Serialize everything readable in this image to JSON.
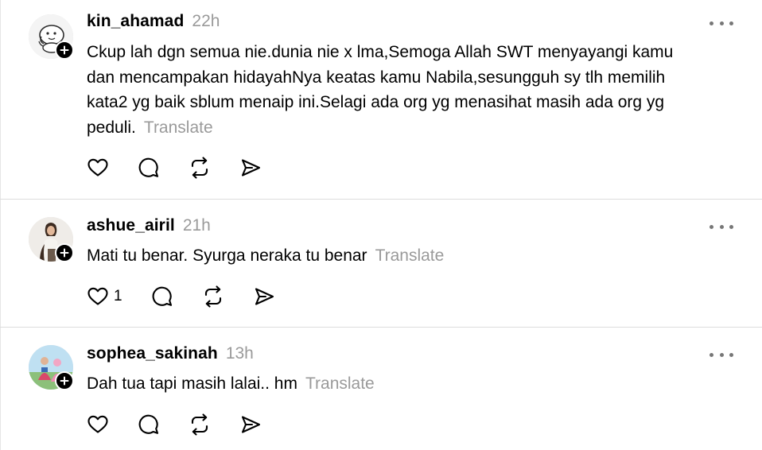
{
  "colors": {
    "text": "#000000",
    "muted": "#9a9a9a",
    "divider": "#dcdcdc",
    "badge": "#000000"
  },
  "icons": {
    "like": "heart-icon",
    "reply": "speech-bubble-icon",
    "repost": "repost-arrows-icon",
    "share": "paper-plane-icon",
    "more": "more-horizontal-icon",
    "follow": "plus-icon"
  },
  "posts": [
    {
      "username": "kin_ahamad",
      "time": "22h",
      "text_lines": [
        "Ckup lah dgn semua nie.dunia nie x lma,Semoga Allah SWT menyayangi kamu",
        "dan mencampakan hidayahNya keatas kamu Nabila,sesungguh sy tlh memilih",
        "kata2 yg baik sblum menaip ini.Selagi ada org yg menasihat masih ada org yg",
        "peduli."
      ],
      "translate_label": "Translate",
      "like_count": ""
    },
    {
      "username": "ashue_airil",
      "time": "21h",
      "text_lines": [
        "Mati tu benar. Syurga neraka tu benar"
      ],
      "translate_label": "Translate",
      "like_count": "1"
    },
    {
      "username": "sophea_sakinah",
      "time": "13h",
      "text_lines": [
        "Dah tua tapi masih lalai.. hm"
      ],
      "translate_label": "Translate",
      "like_count": ""
    }
  ]
}
